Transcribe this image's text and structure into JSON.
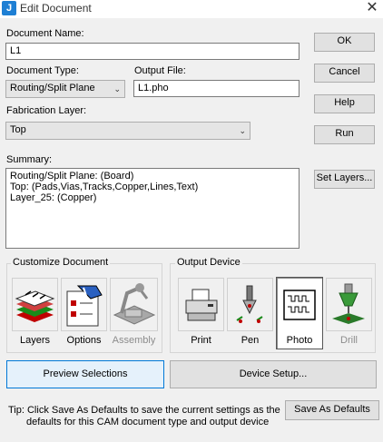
{
  "window": {
    "title": "Edit Document",
    "icon_text": "J"
  },
  "form": {
    "doc_name_label": "Document Name:",
    "doc_name_value": "L1",
    "doc_type_label": "Document Type:",
    "doc_type_value": "Routing/Split Plane",
    "output_file_label": "Output File:",
    "output_file_value": "L1.pho",
    "fab_layer_label": "Fabrication Layer:",
    "fab_layer_value": "Top",
    "summary_label": "Summary:",
    "summary_lines": [
      "Routing/Split Plane: (Board)",
      "Top: (Pads,Vias,Tracks,Copper,Lines,Text)",
      "Layer_25: (Copper)"
    ]
  },
  "buttons": {
    "ok": "OK",
    "cancel": "Cancel",
    "help": "Help",
    "run": "Run",
    "set_layers": "Set Layers...",
    "preview": "Preview Selections",
    "device_setup": "Device Setup...",
    "save_defaults": "Save As Defaults"
  },
  "customize": {
    "label": "Customize Document",
    "items": [
      {
        "label": "Layers",
        "icon": "layers-icon",
        "enabled": true
      },
      {
        "label": "Options",
        "icon": "options-icon",
        "enabled": true
      },
      {
        "label": "Assembly",
        "icon": "assembly-icon",
        "enabled": false
      }
    ]
  },
  "output_device": {
    "label": "Output Device",
    "items": [
      {
        "label": "Print",
        "icon": "printer-icon",
        "enabled": true
      },
      {
        "label": "Pen",
        "icon": "pen-plotter-icon",
        "enabled": true
      },
      {
        "label": "Photo",
        "icon": "photo-plotter-icon",
        "enabled": true,
        "selected": true
      },
      {
        "label": "Drill",
        "icon": "drill-icon",
        "enabled": false
      }
    ]
  },
  "tip": {
    "line1": "Tip: Click Save As Defaults to save the current settings as the",
    "line2": "defaults for this CAM document type and output device"
  }
}
